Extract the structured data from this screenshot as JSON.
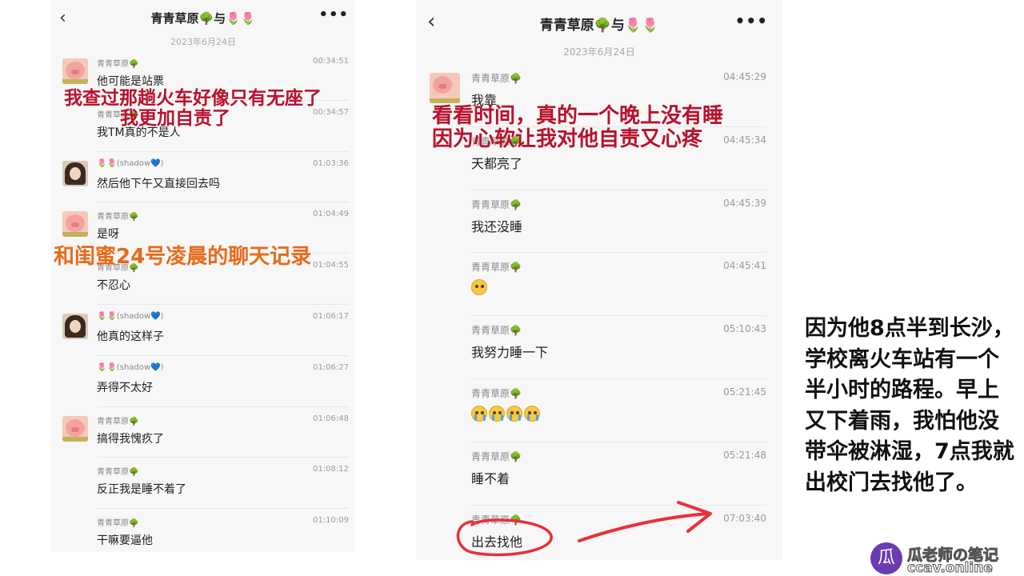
{
  "left_chat": {
    "title": "青青草原🌳与🌷🌷",
    "date": "2023年6月24日",
    "messages": [
      {
        "sender": "青青草原🌳",
        "time": "00:34:51",
        "text": "他可能是站票"
      },
      {
        "sender": "青青草原🌳",
        "time": "00:34:57",
        "text": "我TM真的不是人"
      },
      {
        "sender": "🌷🌷(shadow💙)",
        "time": "01:03:36",
        "text": "然后他下午又直接回去吗"
      },
      {
        "sender": "青青草原🌳",
        "time": "01:04:49",
        "text": "是呀"
      },
      {
        "sender": "青青草原🌳",
        "time": "01:04:55",
        "text": "不忍心"
      },
      {
        "sender": "🌷🌷(shadow💙)",
        "time": "01:06:17",
        "text": "他真的这样子"
      },
      {
        "sender": "🌷🌷(shadow💙)",
        "time": "01:06:27",
        "text": "弄得不太好"
      },
      {
        "sender": "青青草原🌳",
        "time": "01:06:48",
        "text": "搞得我愧疚了"
      },
      {
        "sender": "青青草原🌳",
        "time": "01:08:12",
        "text": "反正我是睡不着了"
      },
      {
        "sender": "青青草原🌳",
        "time": "01:10:09",
        "text": "干嘛要逼他"
      }
    ]
  },
  "right_chat": {
    "title": "青青草原🌳与🌷🌷",
    "date": "2023年6月24日",
    "messages": [
      {
        "sender": "青青草原🌳",
        "time": "04:45:29",
        "text": "我靠"
      },
      {
        "sender": "青青草原🌳",
        "time": "04:45:34",
        "text": "天都亮了"
      },
      {
        "sender": "青青草原🌳",
        "time": "04:45:39",
        "text": "我还没睡"
      },
      {
        "sender": "青青草原🌳",
        "time": "04:45:41",
        "text": ""
      },
      {
        "sender": "青青草原🌳",
        "time": "05:10:43",
        "text": "我努力睡一下"
      },
      {
        "sender": "青青草原🌳",
        "time": "05:21:45",
        "text": ""
      },
      {
        "sender": "青青草原🌳",
        "time": "05:21:48",
        "text": "睡不着"
      },
      {
        "sender": "青青草原🌳",
        "time": "07:03:40",
        "text": "出去找他"
      }
    ]
  },
  "overlays": {
    "left_red_line1": "我查过那趟火车好像只有无座了",
    "left_red_line2": "我更加自责了",
    "left_orange": "和闺蜜24号凌晨的聊天记录",
    "right_red_line1": "看看时间，真的一个晚上没有睡",
    "right_red_line2": "因为心软让我对他自责又心疼"
  },
  "side_text": "因为他8点半到长沙，学校离火车站有一个半小时的路程。早上又下着雨，我怕他没带伞被淋湿，7点我就出校门去找他了。",
  "watermark": {
    "logo": "瓜",
    "name": "瓜老师の笔记",
    "url": "ccav.online"
  },
  "icons": {
    "back": "back-chevron-icon",
    "more": "more-dots-icon",
    "emoji_dizzy": "dizzy-face-emoji",
    "emoji_crying": "loudly-crying-face-emoji"
  },
  "colors": {
    "overlay_red": "#b8122c",
    "overlay_orange": "#e86a1a",
    "scribble_red": "#e8303a"
  }
}
